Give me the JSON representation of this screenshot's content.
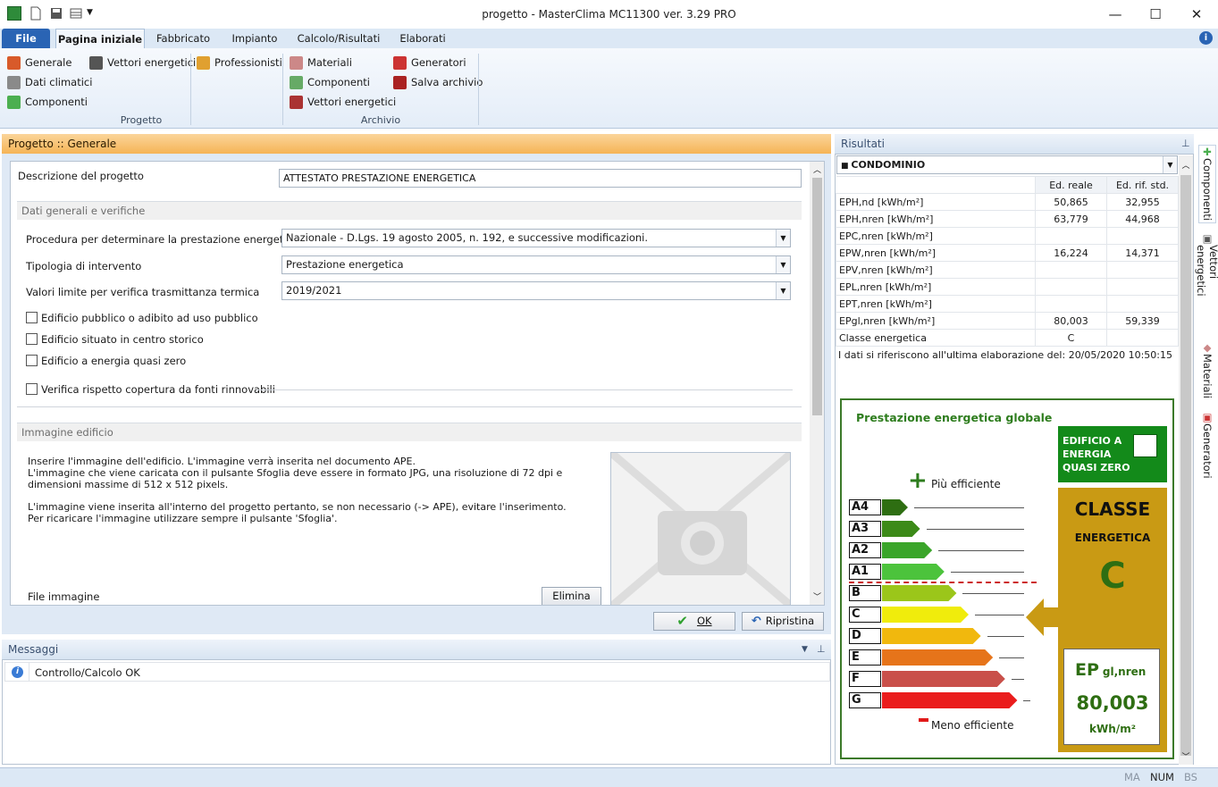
{
  "window": {
    "title": "progetto - MasterClima MC11300 ver. 3.29 PRO"
  },
  "ribbon_tabs": [
    "File",
    "Pagina iniziale",
    "Fabbricato",
    "Impianto",
    "Calcolo/Risultati",
    "Elaborati"
  ],
  "ribbon": {
    "progetto": {
      "generale": "Generale",
      "dati_climatici": "Dati climatici",
      "componenti": "Componenti",
      "vettori": "Vettori energetici",
      "professionisti": "Professionisti",
      "label": "Progetto"
    },
    "archivio": {
      "materiali": "Materiali",
      "componenti": "Componenti",
      "vettori": "Vettori energetici",
      "generatori": "Generatori",
      "salva": "Salva archivio",
      "label": "Archivio"
    }
  },
  "main": {
    "header": "Progetto :: Generale",
    "descrizione_label": "Descrizione del progetto",
    "descrizione_value": "ATTESTATO PRESTAZIONE ENERGETICA",
    "group_dati": "Dati generali e verifiche",
    "procedura_label": "Procedura per determinare la prestazione energetica",
    "procedura_value": "Nazionale - D.Lgs. 19 agosto 2005, n. 192, e successive modificazioni.",
    "tipologia_label": "Tipologia di intervento",
    "tipologia_value": "Prestazione energetica",
    "valori_label": "Valori limite per verifica trasmittanza termica",
    "valori_value": "2019/2021",
    "chk1": "Edificio pubblico o adibito ad uso pubblico",
    "chk2": "Edificio situato in centro storico",
    "chk3": "Edificio a energia quasi zero",
    "chk4": "Verifica rispetto copertura da fonti rinnovabili",
    "group_immagine": "Immagine edificio",
    "img_text1": "Inserire l'immagine dell'edificio. L'immagine verrà inserita nel documento APE.",
    "img_text2": "L'immagine che viene caricata con il pulsante Sfoglia deve essere in formato JPG, una risoluzione di 72 dpi e",
    "img_text3": "dimensioni massime di 512 x 512 pixels.",
    "img_text4": "L'immagine viene inserita all'interno del progetto pertanto, se non necessario (-> APE), evitare l'inserimento.",
    "img_text5": "Per ricaricare l'immagine utilizzare sempre il pulsante 'Sfoglia'.",
    "file_label": "File immagine",
    "elimina": "Elimina",
    "ok": "OK",
    "ripristina": "Ripristina"
  },
  "messages": {
    "header": "Messaggi",
    "row": "Controllo/Calcolo OK"
  },
  "results": {
    "header": "Risultati",
    "building": "CONDOMINIO",
    "col_real": "Ed. reale",
    "col_ref": "Ed. rif. std.",
    "rows": [
      {
        "k": "EPH,nd [kWh/m²]",
        "a": "50,865",
        "b": "32,955"
      },
      {
        "k": "EPH,nren [kWh/m²]",
        "a": "63,779",
        "b": "44,968"
      },
      {
        "k": "EPC,nren [kWh/m²]",
        "a": "",
        "b": ""
      },
      {
        "k": "EPW,nren [kWh/m²]",
        "a": "16,224",
        "b": "14,371"
      },
      {
        "k": "EPV,nren [kWh/m²]",
        "a": "",
        "b": ""
      },
      {
        "k": "EPL,nren [kWh/m²]",
        "a": "",
        "b": ""
      },
      {
        "k": "EPT,nren [kWh/m²]",
        "a": "",
        "b": ""
      },
      {
        "k": "EPgl,nren [kWh/m²]",
        "a": "80,003",
        "b": "59,339"
      },
      {
        "k": "Classe energetica",
        "a": "C",
        "b": ""
      }
    ],
    "footer": "I dati si riferiscono all'ultima elaborazione del: 20/05/2020 10:50:15"
  },
  "energy": {
    "title": "Prestazione energetica globale",
    "piu": "Più efficiente",
    "meno": "Meno efficiente",
    "nzeb": "EDIFICIO A ENERGIA QUASI ZERO",
    "classe_title": "CLASSE",
    "classe_sub": "ENERGETICA",
    "classe": "C",
    "ep_label": "EP",
    "ep_sub": "gl,nren",
    "ep_value": "80,003",
    "ep_unit": "kWh/m²",
    "classes": [
      "A4",
      "A3",
      "A2",
      "A1",
      "B",
      "C",
      "D",
      "E",
      "F",
      "G"
    ],
    "colors": [
      "#2e6e12",
      "#3c8a18",
      "#3aa52a",
      "#4cc33c",
      "#9bc61a",
      "#f0ec0c",
      "#f1b80d",
      "#e6741a",
      "#c9504a",
      "#ea1c1c"
    ]
  },
  "side_tabs": [
    "Componenti",
    "Vettori energetici",
    "Materiali",
    "Generatori"
  ],
  "status": [
    "MA",
    "NUM",
    "BS"
  ]
}
